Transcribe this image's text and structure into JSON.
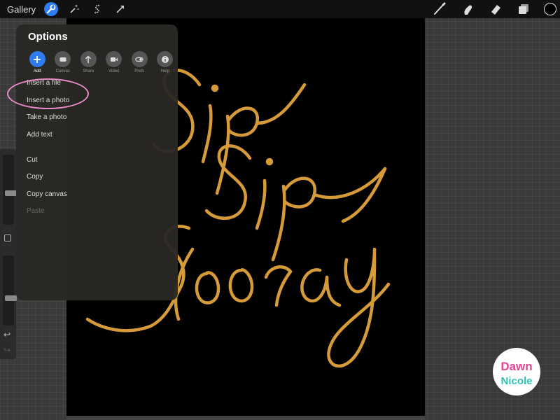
{
  "toolbar": {
    "gallery": "Gallery",
    "left_icons": [
      "wrench-icon",
      "magic-wand-icon",
      "selection-icon",
      "transform-icon"
    ],
    "right_icons": [
      "brush-icon",
      "smudge-icon",
      "eraser-icon",
      "layers-icon"
    ],
    "current_color": "#000000",
    "accent_color": "#2f7bf0"
  },
  "options": {
    "title": "Options",
    "tabs": [
      {
        "label": "Add",
        "icon": "plus-icon"
      },
      {
        "label": "Canvas",
        "icon": "canvas-icon"
      },
      {
        "label": "Share",
        "icon": "share-icon"
      },
      {
        "label": "Video",
        "icon": "video-icon"
      },
      {
        "label": "Prefs",
        "icon": "toggle-icon"
      },
      {
        "label": "Help",
        "icon": "info-icon"
      }
    ],
    "menu": [
      {
        "label": "Insert a file",
        "enabled": true
      },
      {
        "label": "Insert a photo",
        "enabled": true
      },
      {
        "label": "Take a photo",
        "enabled": true
      },
      {
        "label": "Add text",
        "enabled": true
      },
      {
        "label": "Cut",
        "enabled": true
      },
      {
        "label": "Copy",
        "enabled": true
      },
      {
        "label": "Copy canvas",
        "enabled": true
      },
      {
        "label": "Paste",
        "enabled": false
      }
    ]
  },
  "sidebar": {
    "brush_size_level": 0.55,
    "opacity_level": 0.62,
    "undo_icon": "undo-icon",
    "redo_icon": "redo-icon"
  },
  "canvas": {
    "artwork": "hand-lettering-artwork",
    "lettering_color": "#e2a43c"
  },
  "logo": {
    "line1": "Dawn",
    "line2": "Nicole"
  }
}
